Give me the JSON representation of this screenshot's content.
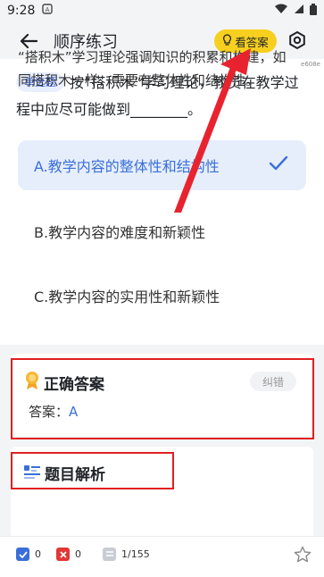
{
  "status_bar": {
    "time": "9:28",
    "notification_icon": "app-notification-icon",
    "signal_icons": [
      "wifi-icon",
      "signal-icon",
      "battery-icon"
    ]
  },
  "header": {
    "title": "顺序练习",
    "show_answer_label": "看答案",
    "device_id": "e608e"
  },
  "question": {
    "type_label": "单选题",
    "text": "按“搭积木”学习理论，教员在教学过程中应尽可能做到________。"
  },
  "options": [
    {
      "label": "A.教学内容的整体性和结构性",
      "selected": true
    },
    {
      "label": "B.教学内容的难度和新颖性",
      "selected": false
    },
    {
      "label": "C.教学内容的实用性和新颖性",
      "selected": false
    }
  ],
  "answer": {
    "title": "正确答案",
    "report_label": "纠错",
    "answer_prefix": "答案：",
    "answer_value": "A"
  },
  "analysis": {
    "title": "题目解析",
    "text": "“搭积木”学习理论强调知识的积累和构建，如同搭积木一样，需要有整体性和结构性。"
  },
  "bottom": {
    "correct_count": "0",
    "wrong_count": "0",
    "progress": "1/155"
  },
  "colors": {
    "accent": "#3a6fd8",
    "highlight": "#f7cf1e",
    "annotation_red": "#e02020"
  }
}
